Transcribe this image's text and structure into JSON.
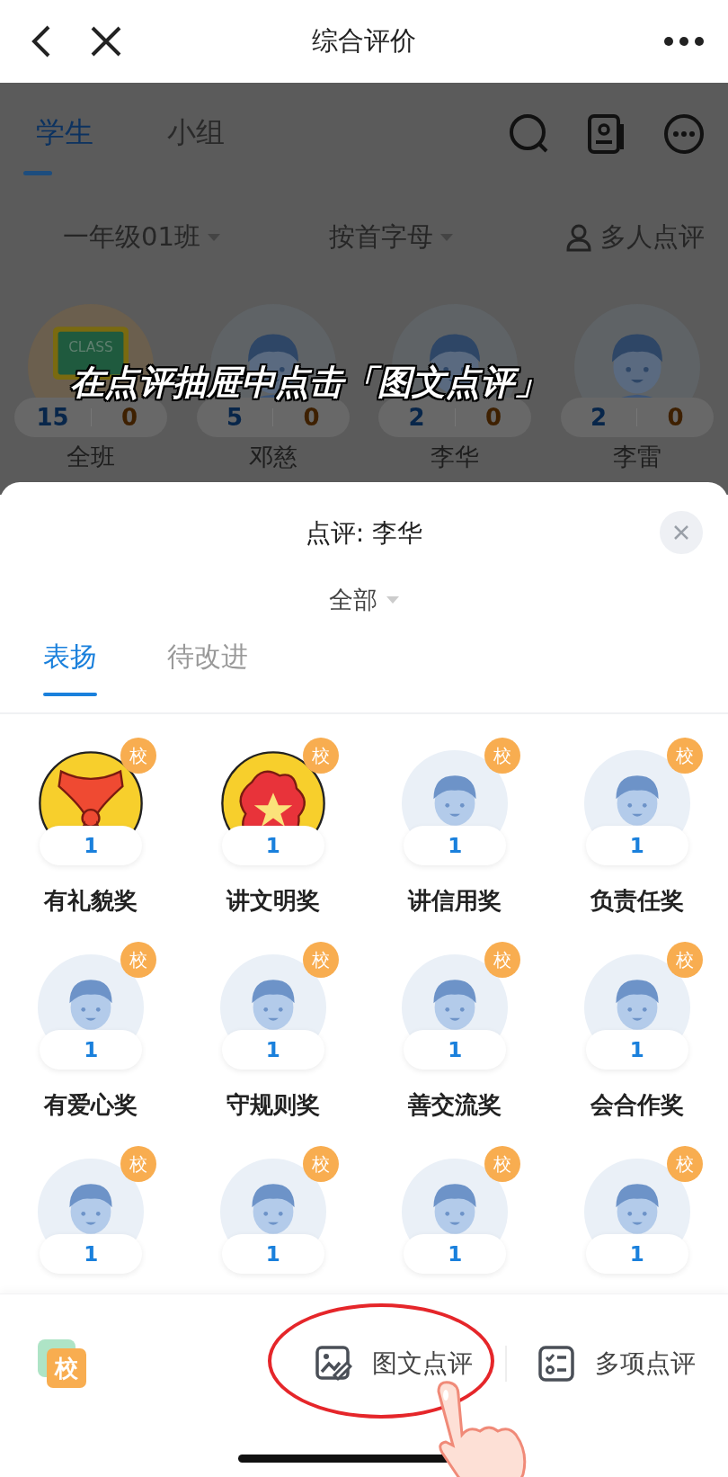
{
  "nav": {
    "title": "综合评价"
  },
  "background": {
    "tabs": [
      {
        "label": "学生",
        "selected": true
      },
      {
        "label": "小组",
        "selected": false
      }
    ],
    "filters": [
      {
        "label": "一年级01班",
        "kind": "dropdown"
      },
      {
        "label": "按首字母",
        "kind": "dropdown"
      },
      {
        "label": "多人点评",
        "kind": "action"
      }
    ],
    "students": [
      {
        "name": "全班",
        "kind": "class",
        "board_text": "CLASS",
        "praise": "15",
        "improve": "0"
      },
      {
        "name": "邓慈",
        "kind": "boy",
        "praise": "5",
        "improve": "0"
      },
      {
        "name": "李华",
        "kind": "boy",
        "praise": "2",
        "improve": "0"
      },
      {
        "name": "李雷",
        "kind": "boy",
        "praise": "2",
        "improve": "0"
      }
    ]
  },
  "caption": "在点评抽屉中点击「图文点评」",
  "sheet": {
    "title": "点评: 李华",
    "filter": "全部",
    "tabs": [
      {
        "label": "表扬",
        "selected": true
      },
      {
        "label": "待改进",
        "selected": false
      }
    ],
    "awards": [
      {
        "name": "有礼貌奖",
        "kind": "scarf",
        "badge": "校",
        "count": "1"
      },
      {
        "name": "讲文明奖",
        "kind": "emblem",
        "badge": "校",
        "count": "1"
      },
      {
        "name": "讲信用奖",
        "kind": "boy",
        "badge": "校",
        "count": "1"
      },
      {
        "name": "负责任奖",
        "kind": "boy",
        "badge": "校",
        "count": "1"
      },
      {
        "name": "有爱心奖",
        "kind": "boy",
        "badge": "校",
        "count": "1"
      },
      {
        "name": "守规则奖",
        "kind": "boy",
        "badge": "校",
        "count": "1"
      },
      {
        "name": "善交流奖",
        "kind": "boy",
        "badge": "校",
        "count": "1"
      },
      {
        "name": "会合作奖",
        "kind": "boy",
        "badge": "校",
        "count": "1"
      },
      {
        "kind": "boy",
        "badge": "校",
        "count": "1"
      },
      {
        "kind": "boy",
        "badge": "校",
        "count": "1"
      },
      {
        "kind": "boy",
        "badge": "校",
        "count": "1"
      },
      {
        "kind": "boy",
        "badge": "校",
        "count": "1"
      }
    ]
  },
  "bottom_bar": {
    "school_label": "校",
    "actions": [
      {
        "label": "图文点评",
        "kind": "image-text"
      },
      {
        "label": "多项点评",
        "kind": "multi"
      }
    ],
    "tap_annotation": {
      "kind": "ring-and-hand"
    }
  }
}
